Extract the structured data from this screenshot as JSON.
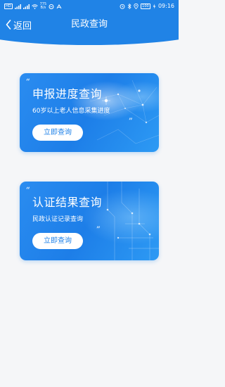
{
  "status_bar": {
    "hd_label": "HD",
    "signal": "4G",
    "speed_value": "775",
    "speed_unit": "B/s",
    "battery": "100",
    "time": "09:16"
  },
  "nav": {
    "back_label": "返回",
    "title": "民政查询"
  },
  "cards": [
    {
      "title": "申报进度查询",
      "subtitle": "60岁以上老人信息采集进度",
      "button_label": "立即查询"
    },
    {
      "title": "认证结果查询",
      "subtitle": "民政认证记录查询",
      "button_label": "立即查询"
    }
  ],
  "colors": {
    "primary": "#2083e6",
    "background": "#f5f6f8",
    "card_button_text": "#1f82e8"
  }
}
